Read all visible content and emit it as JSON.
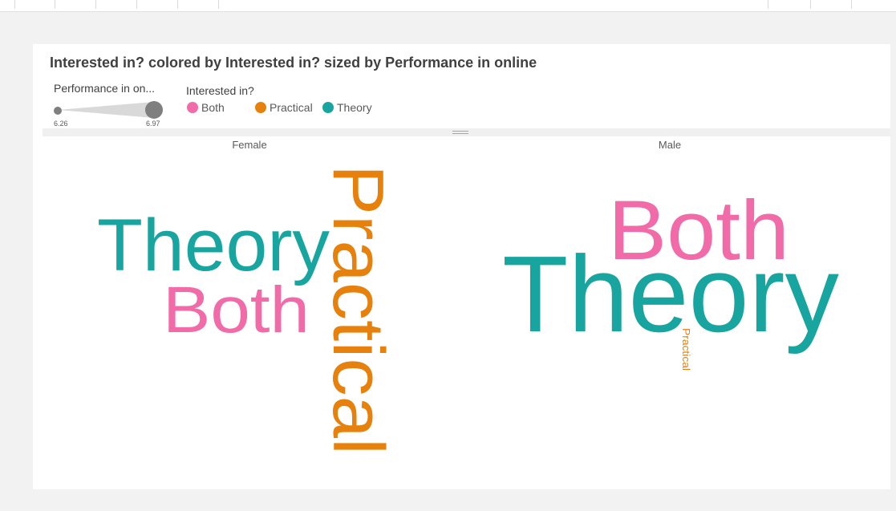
{
  "title": "Interested in? colored by Interested in? sized by Performance in online",
  "size_legend": {
    "title": "Performance in on...",
    "min_label": "6.26",
    "max_label": "6.97"
  },
  "color_legend": {
    "title": "Interested in?",
    "items": [
      {
        "label": "Both",
        "color": "#f06ba8"
      },
      {
        "label": "Practical",
        "color": "#e7810d"
      },
      {
        "label": "Theory",
        "color": "#19a59f"
      }
    ]
  },
  "chart_data": {
    "type": "word-cloud",
    "title": "Interested in? colored by Interested in? sized by Performance in online",
    "color_by": "Interested in?",
    "size_by": "Performance in online",
    "size_range": [
      6.26,
      6.97
    ],
    "panels": [
      {
        "label": "Female",
        "words": [
          {
            "text": "Theory",
            "category": "Theory",
            "value": 6.6,
            "orientation": "horizontal"
          },
          {
            "text": "Both",
            "category": "Both",
            "value": 6.5,
            "orientation": "horizontal"
          },
          {
            "text": "Practical",
            "category": "Practical",
            "value": 6.97,
            "orientation": "vertical"
          }
        ]
      },
      {
        "label": "Male",
        "words": [
          {
            "text": "Both",
            "category": "Both",
            "value": 6.65,
            "orientation": "horizontal"
          },
          {
            "text": "Theory",
            "category": "Theory",
            "value": 6.9,
            "orientation": "horizontal"
          },
          {
            "text": "Practical",
            "category": "Practical",
            "value": 6.26,
            "orientation": "vertical"
          }
        ]
      }
    ]
  }
}
